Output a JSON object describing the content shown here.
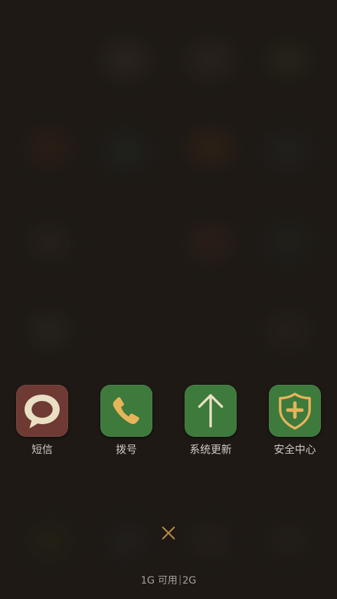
{
  "recent_apps": [
    {
      "label": "短信",
      "icon": "message-bubble-icon",
      "bg": "#6e3a33"
    },
    {
      "label": "拨号",
      "icon": "phone-icon",
      "bg": "#3d7a3c"
    },
    {
      "label": "系统更新",
      "icon": "arrow-up-icon",
      "bg": "#3d7a3c"
    },
    {
      "label": "安全中心",
      "icon": "shield-plus-icon",
      "bg": "#3d7a3c"
    }
  ],
  "close_icon": "close-icon",
  "memory": {
    "available": "1G 可用",
    "total": "2G"
  },
  "colors": {
    "background": "#221d19",
    "accent_gold": "#e6b45a",
    "label_text": "#d2cbc3"
  }
}
